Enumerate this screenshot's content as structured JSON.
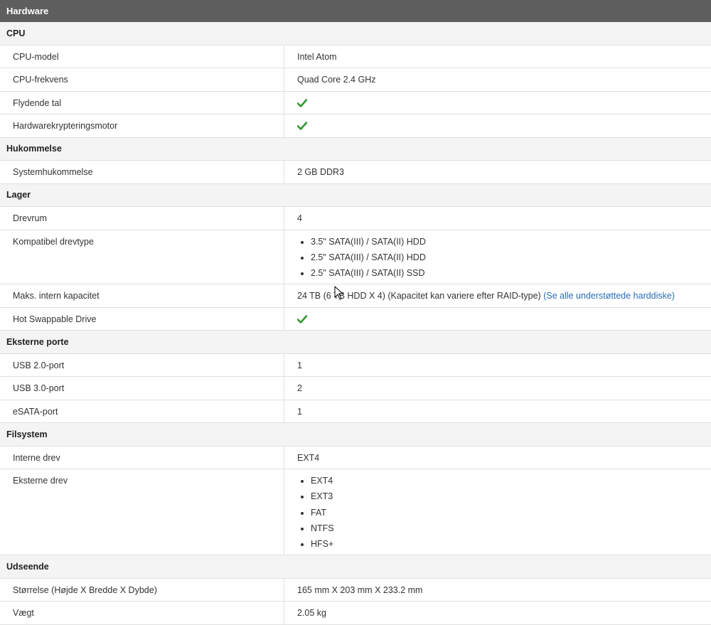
{
  "header": {
    "title": "Hardware"
  },
  "sections": [
    {
      "title": "CPU",
      "rows": [
        {
          "label": "CPU-model",
          "value": "Intel Atom"
        },
        {
          "label": "CPU-frekvens",
          "value": "Quad Core 2.4 GHz"
        },
        {
          "label": "Flydende tal",
          "check": true
        },
        {
          "label": "Hardwarekrypteringsmotor",
          "check": true
        }
      ]
    },
    {
      "title": "Hukommelse",
      "rows": [
        {
          "label": "Systemhukommelse",
          "value": "2 GB DDR3"
        }
      ]
    },
    {
      "title": "Lager",
      "rows": [
        {
          "label": "Drevrum",
          "value": "4"
        },
        {
          "label": "Kompatibel drevtype",
          "list": [
            "3.5\" SATA(III) / SATA(II) HDD",
            "2.5\" SATA(III) / SATA(II) HDD",
            "2.5\" SATA(III) / SATA(II) SSD"
          ]
        },
        {
          "label": "Maks. intern kapacitet",
          "value": "24 TB (6 TB HDD X 4) (Kapacitet kan variere efter RAID-type)",
          "link": "(Se alle understøttede harddiske)"
        },
        {
          "label": "Hot Swappable Drive",
          "check": true
        }
      ]
    },
    {
      "title": "Eksterne porte",
      "rows": [
        {
          "label": "USB 2.0-port",
          "value": "1"
        },
        {
          "label": "USB 3.0-port",
          "value": "2"
        },
        {
          "label": "eSATA-port",
          "value": "1"
        }
      ]
    },
    {
      "title": "Filsystem",
      "rows": [
        {
          "label": "Interne drev",
          "value": "EXT4"
        },
        {
          "label": "Eksterne drev",
          "list": [
            "EXT4",
            "EXT3",
            "FAT",
            "NTFS",
            "HFS+"
          ]
        }
      ]
    },
    {
      "title": "Udseende",
      "rows": [
        {
          "label": "Størrelse (Højde X Bredde X Dybde)",
          "value": "165 mm X 203 mm X 233.2 mm"
        },
        {
          "label": "Vægt",
          "value": "2.05 kg"
        }
      ]
    }
  ],
  "colors": {
    "header_bg": "#5e5e5e",
    "check": "#2e9a2e",
    "link": "#2a6db5"
  },
  "icons": {
    "check": "check-icon",
    "cursor": "mouse-cursor-icon"
  }
}
